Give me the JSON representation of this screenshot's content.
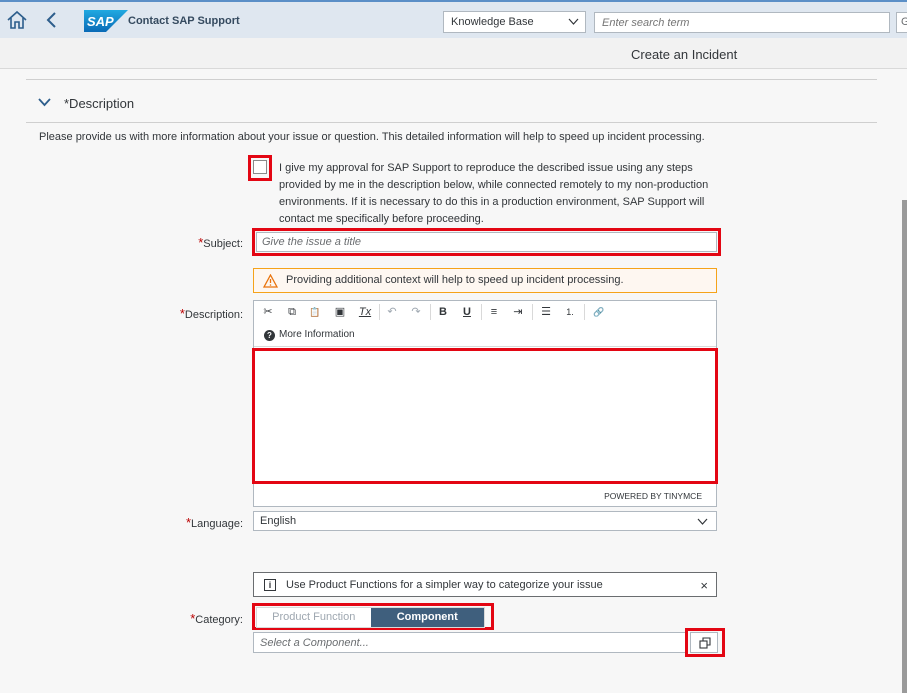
{
  "shell": {
    "logo_text": "SAP",
    "title": "Contact SAP Support",
    "scope_select": "Knowledge Base",
    "search_placeholder": "Enter search term",
    "search_button": "G"
  },
  "subheader": {
    "title": "Create an Incident"
  },
  "section": {
    "title": "*Description",
    "intro": "Please provide us with more information about your issue or question. This detailed information will help to speed up incident processing."
  },
  "approval": {
    "text": "I give my approval for SAP Support to reproduce the described issue using any steps provided by me in the description below, while connected remotely to my non-production environments. If it is necessary to do this in a production environment, SAP Support will contact me specifically before proceeding.",
    "checked": false
  },
  "subject": {
    "required": "*",
    "label": "Subject:",
    "placeholder": "Give the issue a title"
  },
  "warning": {
    "text": "Providing additional context will help to speed up incident processing."
  },
  "description": {
    "required": "*",
    "label": "Description:",
    "toolbar": {
      "cut": "✂",
      "copy": "⧉",
      "paste": "📋",
      "paste_text": "▣",
      "clear_format": "Tx",
      "undo": "↶",
      "redo": "↷",
      "bold": "B",
      "underline": "U",
      "align_left": "≡",
      "align_indent": "⇥",
      "bullet_list": "☰",
      "numbered_list": "1.",
      "link": "🔗"
    },
    "more_info": "More Information",
    "powered_by": "POWERED BY TINYMCE"
  },
  "language": {
    "required": "*",
    "label": "Language:",
    "value": "English"
  },
  "info": {
    "text": "Use Product Functions for a simpler way to categorize your issue",
    "close": "×"
  },
  "category": {
    "required": "*",
    "label": "Category:",
    "options": [
      "Product Function",
      "Component"
    ],
    "selected": "Component",
    "component_placeholder": "Select a Component..."
  },
  "colors": {
    "accent": "#3f5f7d",
    "highlight": "#e30613",
    "warning": "#f5a31a",
    "required": "#bb0000"
  }
}
